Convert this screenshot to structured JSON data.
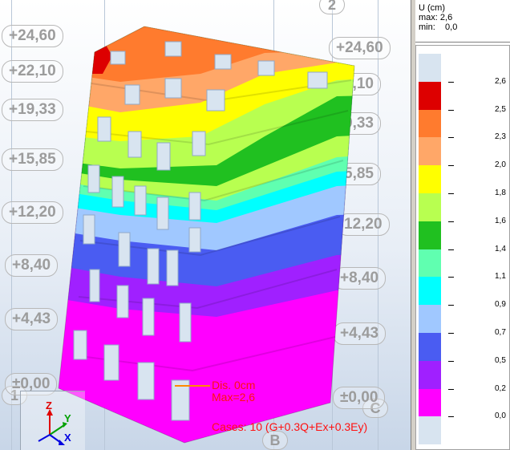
{
  "viewport": {
    "axis_bubbles": [
      "2",
      "1",
      "B",
      "C"
    ],
    "left_levels": [
      "+24,60",
      "+22,10",
      "+19,33",
      "+15,85",
      "+12,20",
      "+8,40",
      "+4,43",
      "±0,00"
    ],
    "right_levels": [
      "+24,60",
      "2,10",
      "9,33",
      "5,85",
      "12,20",
      "+8,40",
      "+4,43",
      "±0,00"
    ],
    "result_info": {
      "dis": "Dis. 0cm",
      "max": "Max=2,6",
      "cases": "Cases: 10 (G+0.3Q+Ex+0.3Ey)"
    },
    "triad": {
      "z": "Z",
      "y": "Y",
      "x": "X"
    }
  },
  "legend": {
    "title": "U (cm)",
    "max_label": "max:",
    "max_value": "2,6",
    "min_label": "min:",
    "min_value": "0,0",
    "colors": [
      "#d8e4f0",
      "#dd0000",
      "#ff7b2e",
      "#ffa768",
      "#ffff00",
      "#b8ff50",
      "#20c020",
      "#60ffb0",
      "#00ffff",
      "#a0c8ff",
      "#4a5cf2",
      "#a020ff",
      "#ff00ff",
      "#d8e4f0"
    ],
    "values": [
      "2,6",
      "2,5",
      "2,3",
      "2,0",
      "1,8",
      "1,6",
      "1,4",
      "1,1",
      "0,9",
      "0,7",
      "0,5",
      "0,2",
      "0,0"
    ],
    "bar_colors": {
      "c0": "#d8e4f0",
      "c1": "#dd0000",
      "c2": "#ff7b2e",
      "c3": "#ffa768",
      "c4": "#ffff00",
      "c5": "#b8ff50",
      "c6": "#20c020",
      "c7": "#60ffb0",
      "c8": "#00ffff",
      "c9": "#a0c8ff",
      "c10": "#4a5cf2",
      "c11": "#a020ff",
      "c12": "#ff00ff",
      "c13": "#d8e4f0"
    }
  }
}
